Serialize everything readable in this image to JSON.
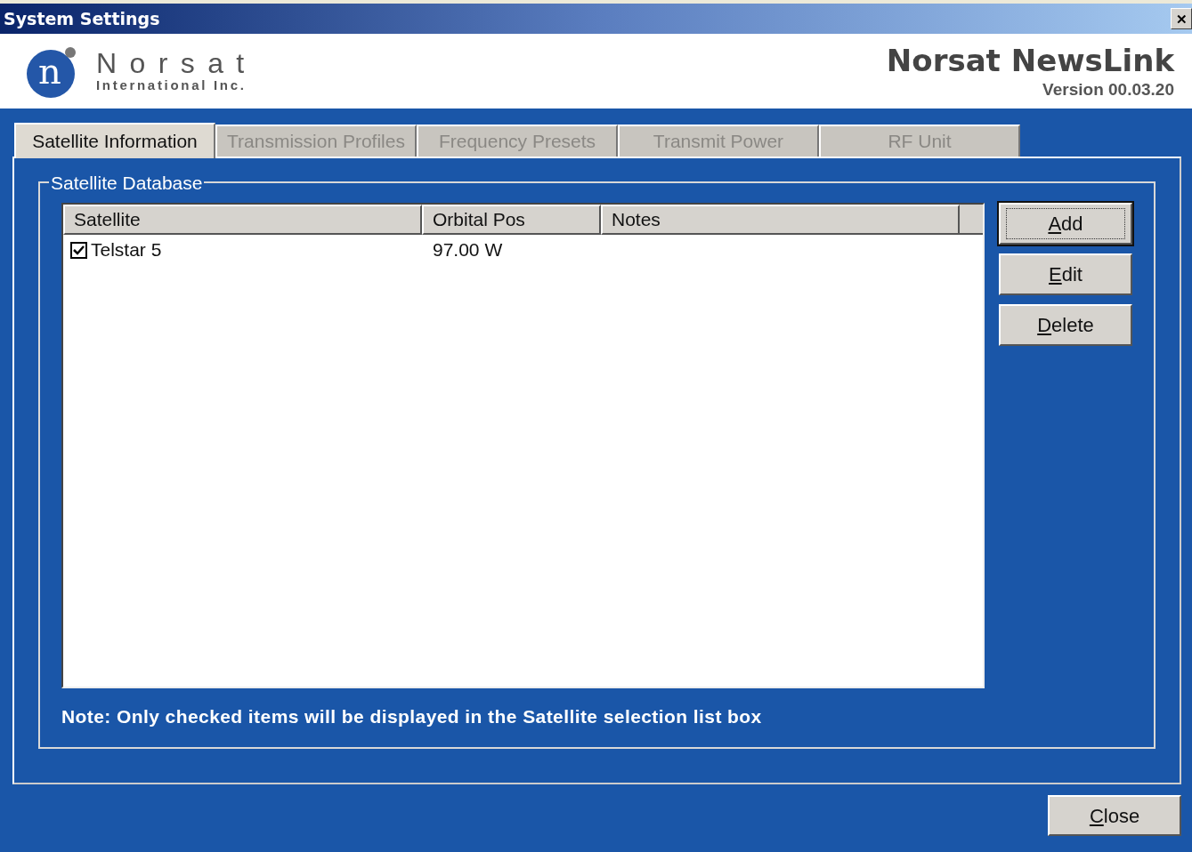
{
  "window": {
    "title": "System Settings",
    "close_glyph": "✕"
  },
  "header": {
    "company": "Norsat",
    "company_sub": "International Inc.",
    "logo_letter": "n",
    "product": "Norsat NewsLink",
    "version": "Version 00.03.20"
  },
  "tabs": [
    {
      "label": "Satellite Information",
      "selected": true
    },
    {
      "label": "Transmission Profiles",
      "selected": false
    },
    {
      "label": "Frequency Presets",
      "selected": false
    },
    {
      "label": "Transmit Power",
      "selected": false
    },
    {
      "label": "RF Unit",
      "selected": false
    }
  ],
  "group": {
    "title": "Satellite Database"
  },
  "table": {
    "columns": [
      "Satellite",
      "Orbital Pos",
      "Notes"
    ],
    "rows": [
      {
        "checked": true,
        "cells": [
          "Telstar 5",
          "97.00 W",
          ""
        ]
      }
    ]
  },
  "side_buttons": [
    {
      "label": "Add",
      "mnemonic": true,
      "focused": true
    },
    {
      "label": "Edit",
      "mnemonic": true,
      "focused": false
    },
    {
      "label": "Delete",
      "mnemonic": true,
      "focused": false
    }
  ],
  "note": "Note: Only checked items will be displayed in the Satellite selection list box",
  "close_button": {
    "label": "Close",
    "mnemonic": true,
    "focused": false
  }
}
